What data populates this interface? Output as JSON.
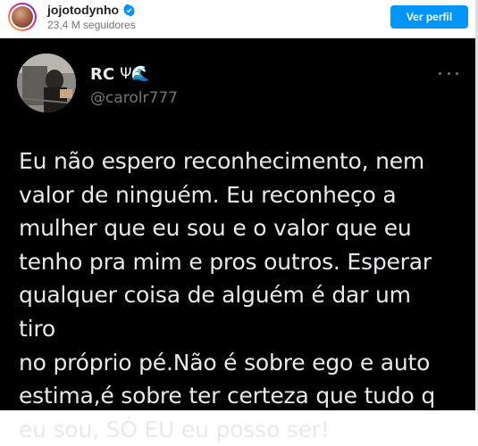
{
  "instagram_embed": {
    "username": "jojotodynho",
    "verified_icon": "verified-badge-icon",
    "followers": "23,4 M seguidores",
    "view_profile_label": "Ver perfil",
    "accent_color": "#0095f6"
  },
  "tweet": {
    "display_name": "RC",
    "name_emoji": "Ψ🌊",
    "handle": "@carolr777",
    "more_icon": "more-options-icon",
    "text_lines": [
      "Eu não espero reconhecimento, nem",
      "valor de ninguém. Eu reconheço a",
      "mulher que eu sou e o valor que eu",
      "tenho pra mim e pros outros. Esperar",
      "qualquer coisa de alguém é dar um tiro",
      "no próprio pé.Não é sobre ego e auto",
      "estima,é sobre ter certeza que tudo q",
      "eu sou, SÓ EU eu posso ser!"
    ],
    "background_color": "#000000",
    "text_color": "#e7e9ea",
    "handle_color": "#71767b"
  }
}
